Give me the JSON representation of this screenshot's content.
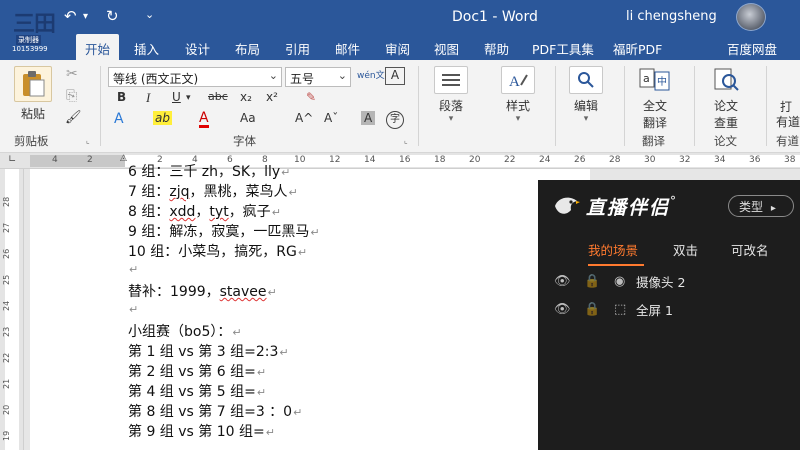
{
  "titlebar": {
    "doc_title": "Doc1  -  Word",
    "user_name": "li chengsheng",
    "undo_icon": "↶",
    "undo_dropdown": "▾",
    "redo_icon": "↻",
    "customize_icon": "⌄",
    "accent_color": "#2b579a"
  },
  "logo_badge": {
    "text": "三田",
    "sub": "录制器",
    "id": "10153999"
  },
  "tabs": [
    "开始",
    "插入",
    "设计",
    "布局",
    "引用",
    "邮件",
    "审阅",
    "视图",
    "帮助",
    "PDF工具集",
    "福昕PDF",
    "百度网盘"
  ],
  "ribbon": {
    "clipboard": {
      "paste_label": "粘贴",
      "group_label": "剪贴板",
      "cut_icon": "✂",
      "copy_icon": "⎘",
      "format_painter_icon": "🖌"
    },
    "font": {
      "font_name": "等线 (西文正文)",
      "font_size": "五号",
      "wen_label": "wén文",
      "a_box_label": "A",
      "bold": "B",
      "italic": "I",
      "underline": "U",
      "strikethrough": "abc",
      "subscript": "x₂",
      "superscript": "x²",
      "clear_icon": "✎",
      "text_effects": "A",
      "highlight": "ab",
      "font_color": "A",
      "change_case": "Aa",
      "grow_font": "A^",
      "shrink_font": "Aˇ",
      "char_shading": "A",
      "enclose_char": "字",
      "group_label": "字体"
    },
    "paragraph": {
      "label": "段落"
    },
    "styles": {
      "label": "样式"
    },
    "editing": {
      "label": "编辑"
    },
    "translate": {
      "label_1": "全文",
      "label_2": "翻译",
      "group_label": "翻译"
    },
    "paper_check": {
      "label_1": "论文",
      "label_2": "查重",
      "group_label": "论文"
    },
    "cloud": {
      "label_1": "有道",
      "group_label": "有道"
    },
    "more": {
      "label": "打"
    }
  },
  "ruler": {
    "h_ticks": [
      "4",
      "2",
      "2",
      "4",
      "6",
      "8",
      "10",
      "12",
      "14",
      "16",
      "18",
      "20",
      "22",
      "24",
      "26",
      "28",
      "30",
      "32",
      "34",
      "36",
      "38"
    ],
    "v_ticks": [
      "28",
      "27",
      "26",
      "25",
      "24",
      "23",
      "22",
      "21",
      "20",
      "19",
      "18"
    ]
  },
  "document": {
    "lines": [
      {
        "text": "6 组：三千 zh，SK，lly",
        "mark": "↵"
      },
      {
        "text": "7 组：zjq，黑桃，菜鸟人",
        "mark": "↵"
      },
      {
        "text": "8 组：xdd，tyt，疯子",
        "mark": "↵"
      },
      {
        "text": "9 组：解冻，寂寞，一匹黑马",
        "mark": "↵"
      },
      {
        "text": "10 组：小菜鸟，搞死，RG",
        "mark": "↵"
      },
      {
        "text": "",
        "mark": "↵"
      },
      {
        "text": "替补：1999，stavee",
        "mark": "↵"
      },
      {
        "text": "",
        "mark": "↵"
      },
      {
        "text": "小组赛（bo5）：",
        "mark": "↵"
      },
      {
        "text": "第 1 组 vs 第 3 组=2:3",
        "mark": "↵"
      },
      {
        "text": "第 2 组 vs 第 6 组=",
        "mark": "↵"
      },
      {
        "text": "第 4 组 vs 第 5 组=",
        "mark": "↵"
      },
      {
        "text": "第 8 组 vs 第 7 组=3   ：0",
        "mark": "↵"
      },
      {
        "text": "第 9 组 vs 第 10 组=",
        "mark": "↵"
      }
    ]
  },
  "overlay": {
    "brand": "直播伴侣",
    "brand_suffix": "°",
    "type_button": "类型",
    "type_arrow": "▸",
    "tabs": [
      "我的场景",
      "双击",
      "可改名"
    ],
    "active_tab_color": "#ff7a2f",
    "scenes": [
      {
        "eye": "👁",
        "lock": "🔒",
        "type_icon": "◉",
        "label": "摄像头 2"
      },
      {
        "eye": "👁",
        "lock": "🔒",
        "type_icon": "⬚",
        "label": "全屏 1"
      }
    ]
  }
}
